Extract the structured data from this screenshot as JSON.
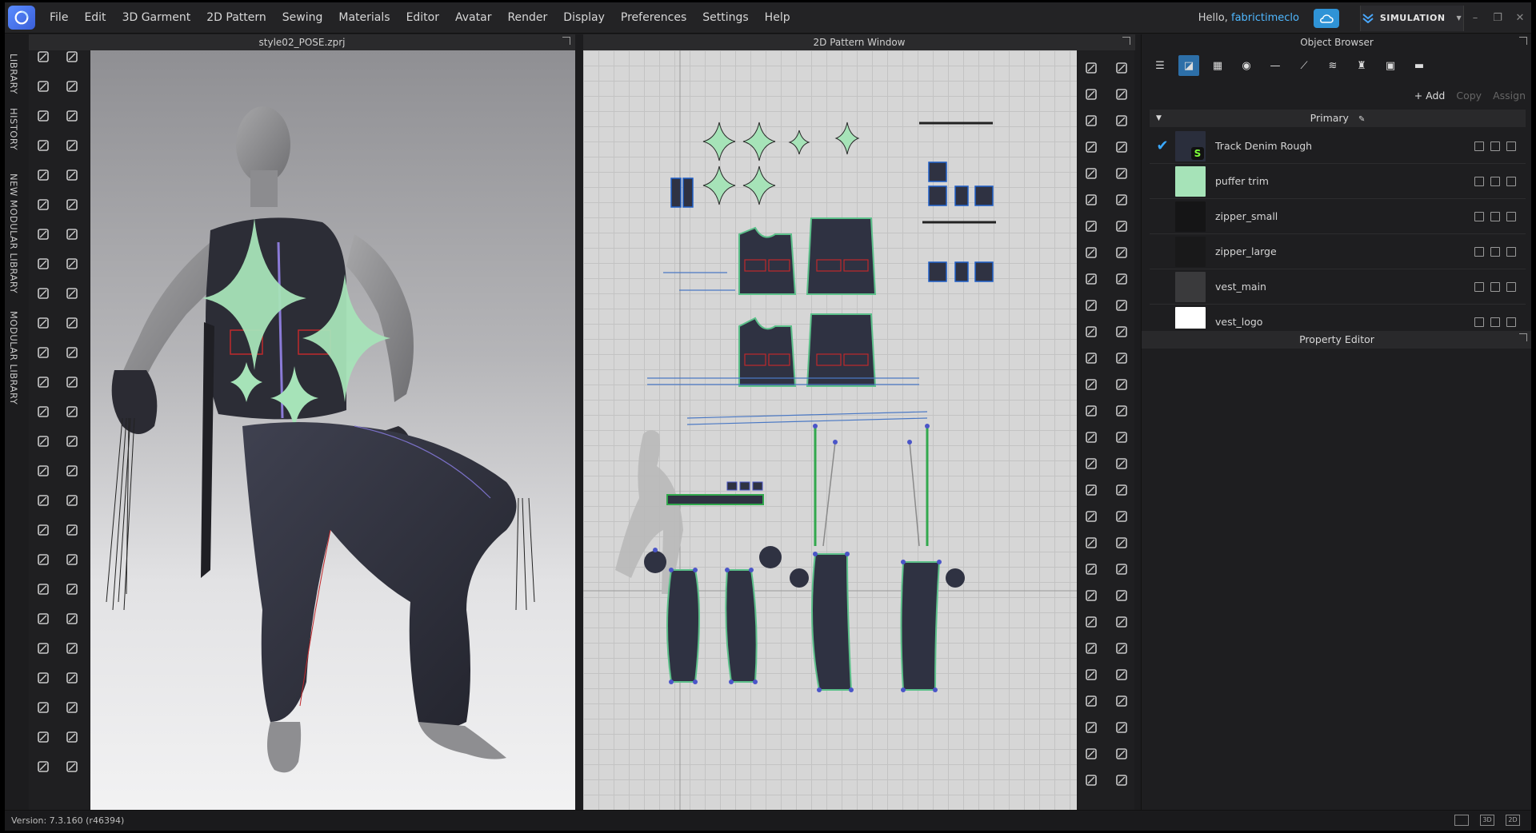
{
  "menu": [
    "File",
    "Edit",
    "3D Garment",
    "2D Pattern",
    "Sewing",
    "Materials",
    "Editor",
    "Avatar",
    "Render",
    "Display",
    "Preferences",
    "Settings",
    "Help"
  ],
  "user": {
    "greeting": "Hello,",
    "name": "fabrictimeclo"
  },
  "mode_button": "SIMULATION",
  "side_tabs": [
    "LIBRARY",
    "HISTORY",
    "NEW MODULAR LIBRARY",
    "MODULAR LIBRARY"
  ],
  "view3d": {
    "title": "style02_POSE.zprj"
  },
  "view2d": {
    "title": "2D Pattern Window"
  },
  "object_browser": {
    "title": "Object Browser",
    "add_label": "+ Add",
    "copy_label": "Copy",
    "assign_label": "Assign",
    "group_label": "Primary",
    "materials": [
      {
        "name": "Track Denim Rough",
        "color": "#2a2e3c",
        "checked": true,
        "badge": "S"
      },
      {
        "name": "puffer trim",
        "color": "#a6e3b8",
        "checked": false
      },
      {
        "name": "zipper_small",
        "color": "#151516",
        "checked": false
      },
      {
        "name": "zipper_large",
        "color": "#19191a",
        "checked": false
      },
      {
        "name": "vest_main",
        "color": "#3a3a3c",
        "checked": false
      },
      {
        "name": "vest_logo",
        "color": "#ffffff",
        "checked": false
      }
    ]
  },
  "property_editor": {
    "title": "Property Editor"
  },
  "status": {
    "version": "Version: 7.3.160 (r46394)",
    "view_labels": [
      "3D",
      "2D"
    ]
  },
  "colors": {
    "accent": "#3aa9ff",
    "trim": "#a6e3b8",
    "denim": "#2f3242",
    "stitch": "#c0292c"
  }
}
